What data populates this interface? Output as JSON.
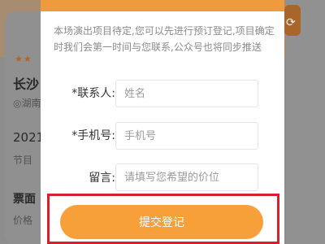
{
  "background": {
    "stars": "★★",
    "title": "长沙",
    "venue": "◎湖南",
    "date": "2021",
    "date_sub": "节目",
    "ticket": "票面",
    "price": "价格"
  },
  "form": {
    "notice": "本场演出项目待定,您可以先进行预订登记,项目确定时我们会第一时间与您联系,公众号也将同步推送",
    "contact_label": "*联系人:",
    "contact_placeholder": "姓名",
    "phone_label": "*手机号:",
    "phone_placeholder": "手机号",
    "message_label": "留言:",
    "message_placeholder": "请填写您希望的价位",
    "submit_label": "提交登记"
  },
  "colors": {
    "accent": "#f7a03a",
    "highlight_frame": "#d6202d"
  }
}
